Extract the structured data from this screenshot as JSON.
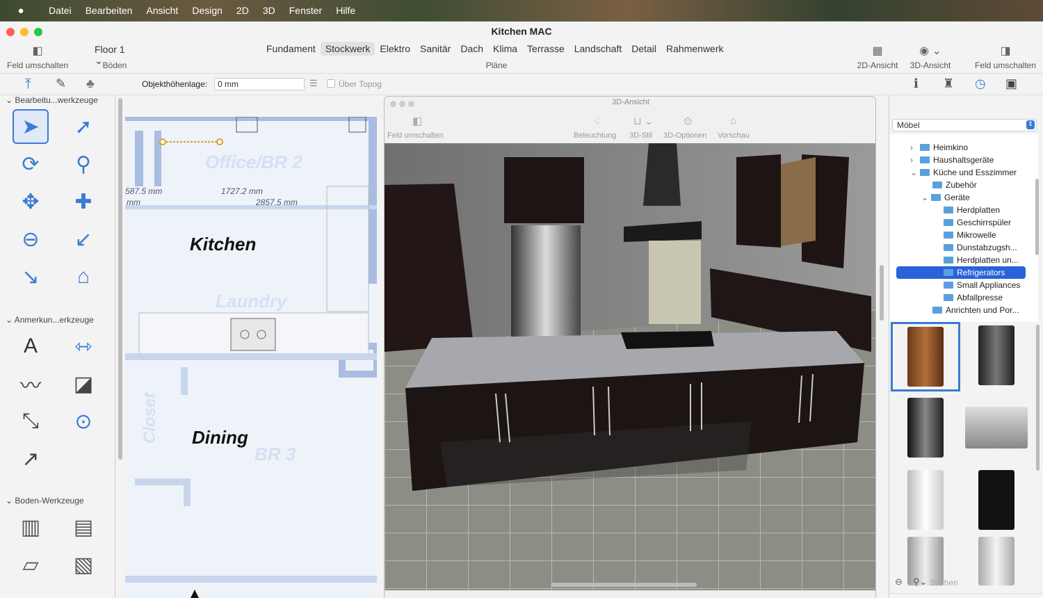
{
  "menubar": {
    "apple": "",
    "items": [
      "Datei",
      "Bearbeiten",
      "Ansicht",
      "Design",
      "2D",
      "3D",
      "Fenster",
      "Hilfe"
    ]
  },
  "window": {
    "title": "Kitchen MAC",
    "toggle_left_label": "Feld umschalten",
    "floor_select": "Floor 1",
    "floors_label": "Böden",
    "plans_label": "Pläne",
    "plan_tabs": [
      "Fundament",
      "Stockwerk",
      "Elektro",
      "Sanitär",
      "Dach",
      "Klima",
      "Terrasse",
      "Landschaft",
      "Detail",
      "Rahmenwerk"
    ],
    "selected_plan": "Stockwerk",
    "view2d_label": "2D-Ansicht",
    "view3d_label": "3D-Ansicht",
    "toggle_right_label": "Feld umschalten"
  },
  "objectbar": {
    "height_label": "Objekthöhenlage:",
    "height_value": "0 mm",
    "topo_label": "Über Topog"
  },
  "left_panel": {
    "sec_edit": "Bearbeitu...werkzeuge",
    "sec_annot": "Anmerkun...erkzeuge",
    "sec_floor": "Boden-Werkzeuge"
  },
  "plan": {
    "room1": "Office/BR 2",
    "room2": "Kitchen",
    "room3": "Laundry",
    "room4": "Dining",
    "room5": "BR 3",
    "room6": "Closet",
    "dim1": "587.5 mm",
    "dim1b": "mm",
    "dim2": "1727.2 mm",
    "dim3": "2857.5 mm"
  },
  "view3d": {
    "title": "3D-Ansicht",
    "toggle_label": "Feld umschalten",
    "lighting": "Beleuchtung",
    "style": "3D-Stil",
    "options": "3D-Optionen",
    "preview": "Vorschau"
  },
  "right_panel": {
    "library_select": "Möbel",
    "tree": [
      {
        "label": "Heimkino",
        "level": 1,
        "chev": "›"
      },
      {
        "label": "Haushaltsgeräte",
        "level": 1,
        "chev": "›"
      },
      {
        "label": "Küche und Esszimmer",
        "level": 1,
        "chev": "⌄"
      },
      {
        "label": "Zubehör",
        "level": 2,
        "chev": ""
      },
      {
        "label": "Geräte",
        "level": 2,
        "chev": "⌄"
      },
      {
        "label": "Herdplatten",
        "level": 3,
        "chev": ""
      },
      {
        "label": "Geschirrspüler",
        "level": 3,
        "chev": ""
      },
      {
        "label": "Mikrowelle",
        "level": 3,
        "chev": ""
      },
      {
        "label": "Dunstabzugsh...",
        "level": 3,
        "chev": ""
      },
      {
        "label": "Herdplatten un...",
        "level": 3,
        "chev": ""
      },
      {
        "label": "Refrigerators",
        "level": 3,
        "chev": "",
        "selected": true
      },
      {
        "label": "Small Appliances",
        "level": 3,
        "chev": ""
      },
      {
        "label": "Abfallpresse",
        "level": 3,
        "chev": ""
      },
      {
        "label": "Anrichten und Por...",
        "level": 2,
        "chev": ""
      }
    ],
    "search_placeholder": "Suchen"
  },
  "colors": {
    "accent": "#3a7bd5",
    "selection": "#2962d9",
    "cabinet": "#2a1c1c",
    "counter": "#9a9ca2",
    "floor": "#8c8d84"
  }
}
